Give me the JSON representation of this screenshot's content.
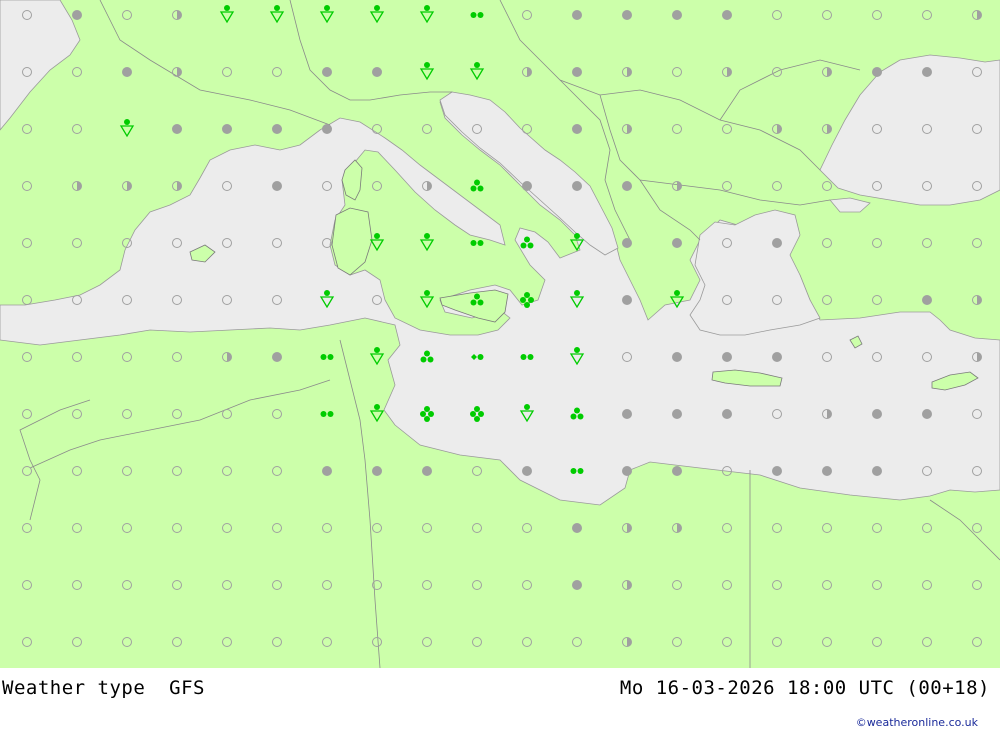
{
  "header": {
    "title": "Weather type",
    "model": "GFS",
    "datetime": "Mo 16-03-2026 18:00 UTC (00+18)"
  },
  "credit": "©weatheronline.co.uk",
  "colors": {
    "land": "#ccff aa",
    "sea": "#ececec",
    "border": "#888888",
    "precip": "#00cc00",
    "cloud": "#a0a0a0"
  },
  "map": {
    "grid_columns": 20,
    "grid_rows": 12,
    "symbols": [
      [
        "clear",
        "overcast",
        "clear",
        "partly",
        "drizzle",
        "drizzle",
        "drizzle",
        "drizzle",
        "drizzle",
        "rain",
        "clear",
        "overcast",
        "overcast",
        "overcast",
        "overcast",
        "clear",
        "clear",
        "clear",
        "clear",
        "partly"
      ],
      [
        "clear",
        "clear",
        "overcast",
        "partly",
        "clear",
        "clear",
        "overcast",
        "overcast",
        "drizzle",
        "drizzle",
        "partly",
        "overcast",
        "partly",
        "clear",
        "partly",
        "clear",
        "partly",
        "overcast",
        "overcast",
        "clear"
      ],
      [
        "clear",
        "clear",
        "drizzle",
        "overcast",
        "overcast",
        "overcast",
        "overcast",
        "clear",
        "clear",
        "clear",
        "clear",
        "overcast",
        "partly",
        "clear",
        "clear",
        "partly",
        "partly",
        "clear",
        "clear",
        "clear"
      ],
      [
        "clear",
        "partly",
        "partly",
        "partly",
        "clear",
        "overcast",
        "clear",
        "clear",
        "partly",
        "snow",
        "overcast",
        "overcast",
        "overcast",
        "partly",
        "clear",
        "clear",
        "clear",
        "clear",
        "clear",
        "clear"
      ],
      [
        "clear",
        "clear",
        "clear",
        "clear",
        "clear",
        "clear",
        "clear",
        "drizzle",
        "drizzle",
        "rain",
        "snow",
        "drizzle",
        "overcast",
        "overcast",
        "clear",
        "overcast",
        "clear",
        "clear",
        "clear",
        "clear"
      ],
      [
        "clear",
        "clear",
        "clear",
        "clear",
        "clear",
        "clear",
        "drizzle",
        "clear",
        "drizzle",
        "snow",
        "snowheavy",
        "drizzle",
        "overcast",
        "drizzle",
        "clear",
        "clear",
        "clear",
        "clear",
        "overcast",
        "partly"
      ],
      [
        "clear",
        "clear",
        "clear",
        "clear",
        "partly",
        "overcast",
        "rain",
        "drizzle",
        "snow",
        "sleet",
        "rain",
        "drizzle",
        "clear",
        "overcast",
        "overcast",
        "overcast",
        "clear",
        "clear",
        "clear",
        "partly"
      ],
      [
        "clear",
        "clear",
        "clear",
        "clear",
        "clear",
        "clear",
        "rain",
        "drizzle",
        "snowheavy",
        "snowheavy",
        "drizzle",
        "snow",
        "overcast",
        "overcast",
        "overcast",
        "clear",
        "partly",
        "overcast",
        "overcast",
        "clear"
      ],
      [
        "clear",
        "clear",
        "clear",
        "clear",
        "clear",
        "clear",
        "overcast",
        "overcast",
        "overcast",
        "clear",
        "overcast",
        "rain",
        "overcast",
        "overcast",
        "clear",
        "overcast",
        "overcast",
        "overcast",
        "clear",
        "clear"
      ],
      [
        "clear",
        "clear",
        "clear",
        "clear",
        "clear",
        "clear",
        "clear",
        "clear",
        "clear",
        "clear",
        "clear",
        "overcast",
        "partly",
        "partly",
        "clear",
        "clear",
        "clear",
        "clear",
        "clear",
        "clear"
      ],
      [
        "clear",
        "clear",
        "clear",
        "clear",
        "clear",
        "clear",
        "clear",
        "clear",
        "clear",
        "clear",
        "clear",
        "overcast",
        "partly",
        "clear",
        "clear",
        "clear",
        "clear",
        "clear",
        "clear",
        "clear"
      ],
      [
        "clear",
        "clear",
        "clear",
        "clear",
        "clear",
        "clear",
        "clear",
        "clear",
        "clear",
        "clear",
        "clear",
        "clear",
        "partly",
        "clear",
        "clear",
        "clear",
        "clear",
        "clear",
        "clear",
        "clear"
      ]
    ]
  }
}
